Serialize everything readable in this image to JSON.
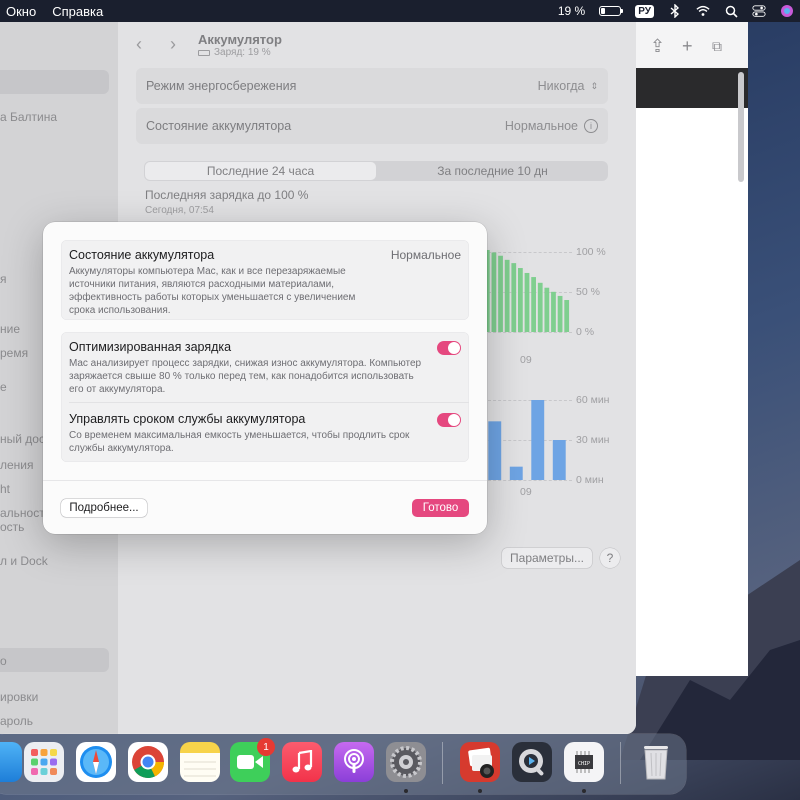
{
  "menubar": {
    "items": [
      "Окно",
      "Справка"
    ],
    "battery_percent_label": "19 %",
    "battery_fraction": 0.19,
    "input_language": "РУ",
    "icons": [
      "bluetooth-icon",
      "wifi-icon",
      "search-icon",
      "control-center-icon",
      "siri-icon"
    ]
  },
  "settings": {
    "sidebar": {
      "items": [
        "а Балтина",
        "я",
        "ние",
        "ремя",
        "е",
        "ный дос",
        "ления",
        "ht",
        "альност",
        "ость",
        "л и Dock",
        "о",
        "ировки",
        "ароль"
      ]
    },
    "title": "Аккумулятор",
    "subtitle": "Заряд: 19 %",
    "energy_mode": {
      "label": "Режим энергосбережения",
      "value": "Никогда"
    },
    "battery_health": {
      "label": "Состояние аккумулятора",
      "value": "Нормальное"
    },
    "segments": {
      "left": "Последние 24 часа",
      "right": "За последние 10 дн"
    },
    "last_charge": {
      "title": "Последняя зарядка до 100 %",
      "time": "Сегодня, 07:54"
    },
    "chart_top": {
      "y_labels": [
        "100 %",
        "50 %",
        "0 %"
      ],
      "x_label": "09"
    },
    "chart_bottom": {
      "y_labels": [
        "60 мин",
        "30 мин",
        "0 мин"
      ],
      "x_label": "09"
    },
    "params_button": "Параметры...",
    "help_button": "?"
  },
  "chart_data": [
    {
      "type": "bar",
      "x": [
        "",
        "",
        "",
        "",
        "",
        "",
        "",
        "",
        "",
        "",
        "",
        "",
        ""
      ],
      "values": [
        100,
        97,
        93,
        88,
        84,
        78,
        72,
        67,
        60,
        54,
        49,
        44,
        39
      ],
      "ylim": [
        0,
        100
      ],
      "color": "#7fcf8f"
    },
    {
      "type": "bar",
      "x": [
        "",
        "",
        "",
        ""
      ],
      "values": [
        44,
        10,
        60,
        30
      ],
      "ylim": [
        0,
        60
      ],
      "color": "#6ea4e4"
    }
  ],
  "modal": {
    "health": {
      "title": "Состояние аккумулятора",
      "value": "Нормальное",
      "desc": "Аккумуляторы компьютера Mac, как и все перезаряжаемые источники питания, являются расходными материалами, эффективность работы которых уменьшается с увеличением срока использования."
    },
    "optimized": {
      "title": "Оптимизированная зарядка",
      "desc": "Mac анализирует процесс зарядки, снижая износ аккумулятора. Компьютер заряжается свыше 80 % только перед тем, как понадобится использовать его от аккумулятора.",
      "enabled": true
    },
    "lifespan": {
      "title": "Управлять сроком службы аккумулятора",
      "desc": "Со временем максимальная емкость уменьшается, чтобы продлить срок службы аккумулятора.",
      "enabled": true
    },
    "more_button": "Подробнее...",
    "done_button": "Готово",
    "accent": "#e5487f"
  },
  "dock": {
    "apps": [
      "finder-icon",
      "launchpad-icon",
      "safari-icon",
      "chrome-icon",
      "notes-icon",
      "facetime-icon",
      "music-icon",
      "podcasts-icon",
      "system-settings-icon",
      "photo-booth-icon",
      "quicktime-icon",
      "system-information-icon",
      "trash-icon"
    ],
    "facetime_badge": "1"
  }
}
